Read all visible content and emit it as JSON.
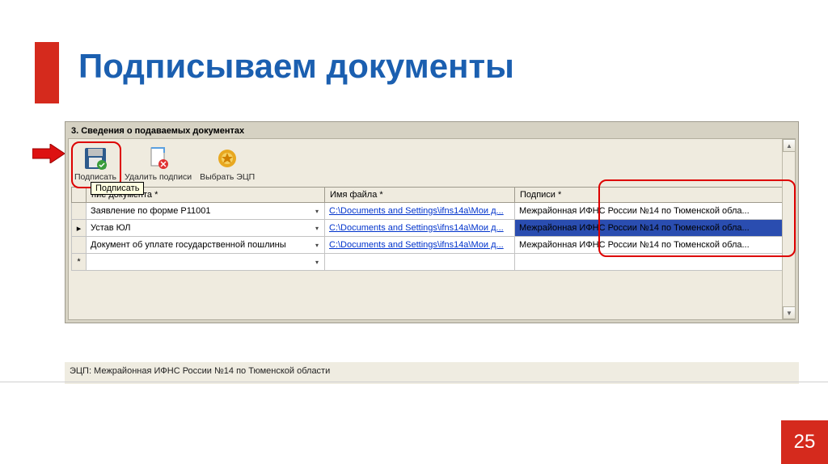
{
  "page_title": "Подписываем документы",
  "section_header": "3. Сведения о подаваемых документах",
  "toolbar": {
    "sign": "Подписать",
    "delete": "Удалить подписи",
    "choose": "Выбрать ЭЦП"
  },
  "tooltip": "Подписать",
  "table": {
    "headers": {
      "doc": "ние документа *",
      "file": "Имя файла *",
      "sig": "Подписи *"
    },
    "rows": [
      {
        "marker": "",
        "doc": "Заявление по форме Р11001",
        "file": "C:\\Documents and Settings\\ifns14a\\Мои д...",
        "sig": "Межрайонная ИФНС России №14 по Тюменской обла...",
        "selected": false
      },
      {
        "marker": "▸",
        "doc": "Устав ЮЛ",
        "file": "C:\\Documents and Settings\\ifns14a\\Мои д...",
        "sig": "Межрайонная ИФНС России №14 по Тюменской обла...",
        "selected": true
      },
      {
        "marker": "",
        "doc": "Документ об уплате государственной пошлины",
        "file": "C:\\Documents and Settings\\ifns14a\\Мои д...",
        "sig": "Межрайонная ИФНС России №14 по Тюменской обла...",
        "selected": false
      },
      {
        "marker": "*",
        "doc": "",
        "file": "",
        "sig": "",
        "selected": false
      }
    ]
  },
  "status_bar": "ЭЦП: Межрайонная ИФНС России №14 по Тюменской области",
  "slide_number": "25"
}
